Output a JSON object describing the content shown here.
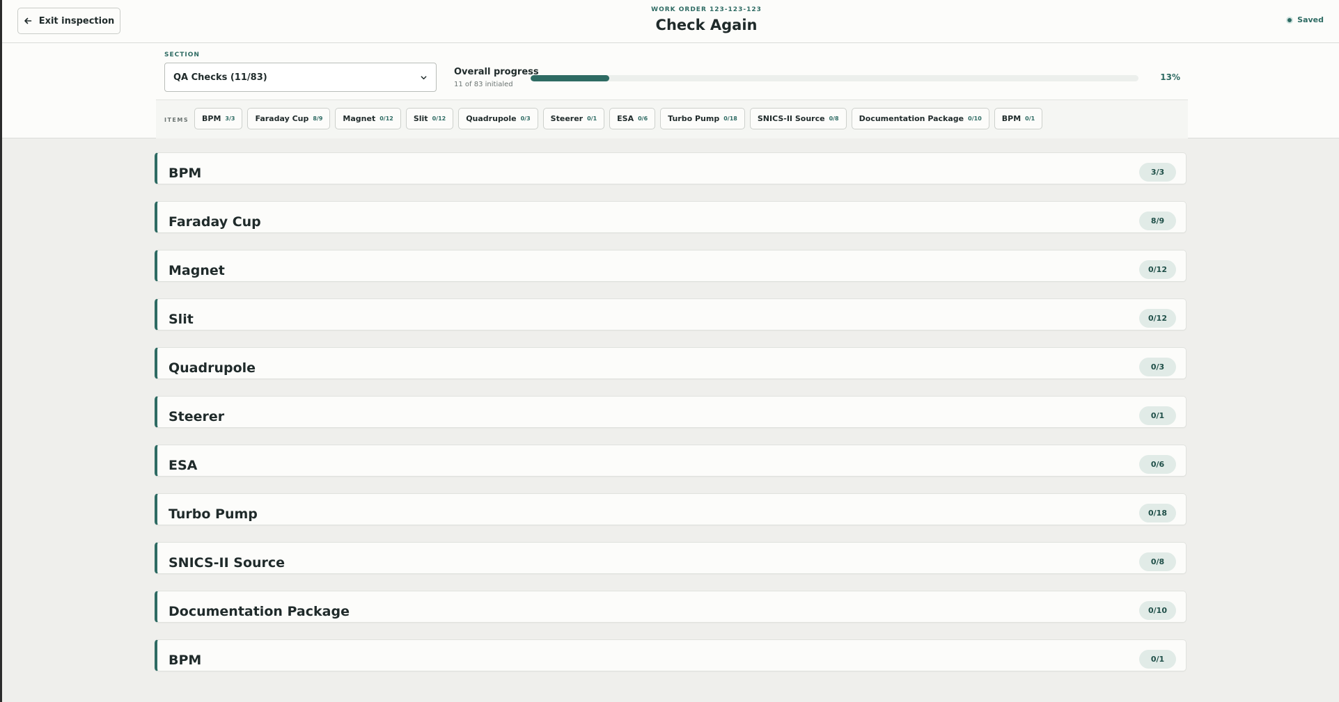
{
  "header": {
    "exit_label": "Exit inspection",
    "work_order_label": "WORK ORDER 123-123-123",
    "title": "Check Again",
    "saved_label": "Saved"
  },
  "section": {
    "label": "SECTION",
    "selected": "QA Checks (11/83)"
  },
  "progress": {
    "title": "Overall progress",
    "subtitle": "11 of 83 initialed",
    "percent_label": "13%",
    "fraction": 0.13
  },
  "items_label": "ITEMS",
  "items": [
    {
      "name": "BPM",
      "count": "3/3"
    },
    {
      "name": "Faraday Cup",
      "count": "8/9"
    },
    {
      "name": "Magnet",
      "count": "0/12"
    },
    {
      "name": "Slit",
      "count": "0/12"
    },
    {
      "name": "Quadrupole",
      "count": "0/3"
    },
    {
      "name": "Steerer",
      "count": "0/1"
    },
    {
      "name": "ESA",
      "count": "0/6"
    },
    {
      "name": "Turbo Pump",
      "count": "0/18"
    },
    {
      "name": "SNICS-II Source",
      "count": "0/8"
    },
    {
      "name": "Documentation Package",
      "count": "0/10"
    },
    {
      "name": "BPM",
      "count": "0/1"
    }
  ],
  "colors": {
    "accent": "#2e6b63",
    "badge_bg": "#e1ebe7",
    "page_bg": "#efefec"
  }
}
